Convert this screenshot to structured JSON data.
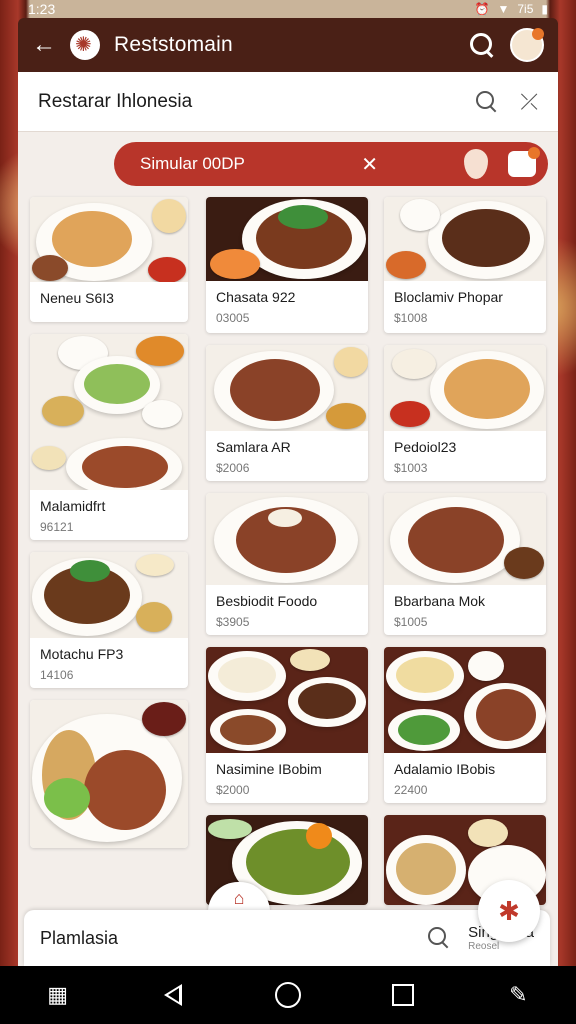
{
  "status_bar": {
    "time": "1:23",
    "battery": "7i5"
  },
  "app_bar": {
    "title": "Reststomain"
  },
  "search": {
    "query": "Restarar Ihlonesia"
  },
  "filter_chip": {
    "label": "Simular 00DP"
  },
  "cards_col1": [
    {
      "name": "Neneu S6I3",
      "price": ""
    },
    {
      "name": "Malamidfrt",
      "price": "96121"
    },
    {
      "name": "Motachu FP3",
      "price": "14106"
    }
  ],
  "cards_col2": [
    {
      "name": "Chasata 922",
      "price": "03005"
    },
    {
      "name": "Samlara AR",
      "price": "$2006"
    },
    {
      "name": "Besbiodit Foodo",
      "price": "$3905"
    },
    {
      "name": "Nasimine IBobim",
      "price": "$2000"
    }
  ],
  "cards_col3": [
    {
      "name": "Bloclamiv Phopar",
      "price": "$1008"
    },
    {
      "name": "Pedoiol23",
      "price": "$1003"
    },
    {
      "name": "Bbarbana Mok",
      "price": "$1005"
    },
    {
      "name": "Adalamio IBobis",
      "price": "22400"
    }
  ],
  "bottom_bar": {
    "left_label": "Plamlasia",
    "right_title": "Singcaola",
    "right_sub": "Reosel"
  },
  "colors": {
    "accent": "#b8352a",
    "header": "#4a2016"
  }
}
